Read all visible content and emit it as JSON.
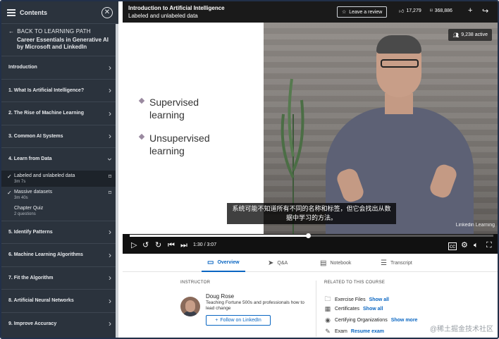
{
  "sidebar": {
    "title": "Contents",
    "back_label": "BACK TO LEARNING PATH",
    "course_title": "Career Essentials in Generative AI by Microsoft and LinkedIn",
    "items_top": [
      {
        "label": "Introduction"
      },
      {
        "label": "1. What Is Artificial Intelligence?"
      },
      {
        "label": "2. The Rise of Machine Learning"
      },
      {
        "label": "3. Common AI Systems"
      },
      {
        "label": "4. Learn from Data"
      }
    ],
    "subitems": [
      {
        "label": "Labeled and unlabeled data",
        "duration": "3m 7s"
      },
      {
        "label": "Massive datasets",
        "duration": "3m 40s"
      },
      {
        "label": "Chapter Quiz",
        "duration": "2 questions"
      }
    ],
    "items_bottom": [
      {
        "label": "5. Identify Patterns"
      },
      {
        "label": "6. Machine Learning Algorithms"
      },
      {
        "label": "7. Fit the Algorithm"
      },
      {
        "label": "8. Artificial Neural Networks"
      },
      {
        "label": "9. Improve Accuracy"
      }
    ]
  },
  "topbar": {
    "course": "Introduction to Artificial Intelligence",
    "lesson": "Labeled and unlabeled data",
    "review_label": "Leave a review",
    "likes": "17,279",
    "saves": "368,886"
  },
  "video": {
    "bullets": [
      "Supervised learning",
      "Unsupervised learning"
    ],
    "active_viewers": "9,238 active",
    "subtitle": "系统可能不知道所有不同的名称和标签，但它会找出从数据中学习的方法。",
    "watermark": "Linkedin Learning",
    "time": "1:30 / 3:07",
    "progress": 0.49
  },
  "tabs": [
    {
      "label": "Overview"
    },
    {
      "label": "Q&A"
    },
    {
      "label": "Notebook"
    },
    {
      "label": "Transcript"
    }
  ],
  "instructor": {
    "heading": "INSTRUCTOR",
    "name": "Doug Rose",
    "bio": "Teaching Fortune 500s and professionals how to lead change",
    "follow_label": "Follow on LinkedIn"
  },
  "related": {
    "heading": "RELATED TO THIS COURSE",
    "rows": [
      {
        "label": "Exercise Files",
        "link": "Show all"
      },
      {
        "label": "Certificates",
        "link": "Show all"
      },
      {
        "label": "Certifying Organizations",
        "link": "Show more"
      },
      {
        "label": "Exam",
        "link": "Resume exam"
      }
    ]
  },
  "corner_watermark": "@稀土掘金技术社区",
  "colors": {
    "accent": "#0a66c2",
    "sidebar_bg": "#2b333d",
    "topbar_bg": "#1a1a1a"
  }
}
